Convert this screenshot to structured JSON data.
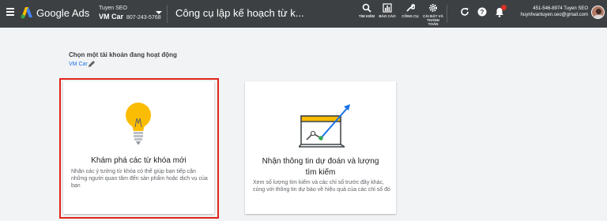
{
  "header": {
    "brand": "Google Ads",
    "account_top": "Tuyen SEO",
    "account_name": "VM Car",
    "account_id": "807-243-5768",
    "page_title": "Công cụ lập kế hoạch từ k...",
    "tools": [
      {
        "label": "TÌM KIẾM",
        "icon": "search-icon"
      },
      {
        "label": "BÁO CÁO",
        "icon": "reports-icon"
      },
      {
        "label": "CÔNG CỤ",
        "icon": "wrench-icon"
      },
      {
        "label1": "CÀI ĐẶT VÀ",
        "label2": "THANH",
        "label3": "TOÁN",
        "icon": "gear-icon"
      }
    ],
    "user_line1": "451-546-8974 Tuyen SEO",
    "user_line2": "huynhvantuyen.seo@gmail.com"
  },
  "content": {
    "choose_label": "Chọn một tài khoản đang hoạt động",
    "account_link": "VM Car"
  },
  "cards": [
    {
      "title": "Khám phá các từ khóa mới",
      "desc": "Nhận các ý tưởng từ khóa có thể giúp bạn tiếp cận những người quan tâm đến sản phẩm hoặc dịch vụ của bạn",
      "icon": "lightbulb-icon"
    },
    {
      "title_line1": "Nhận thông tin dự đoán và lượng",
      "title_line2": "tìm kiếm",
      "desc": "Xem số lượng tìm kiếm và các chỉ số trước đây khác, cùng với thông tin dự báo về hiệu quả của các chỉ số đó",
      "icon": "forecast-chart-icon"
    }
  ],
  "colors": {
    "topbar": "#3c4043",
    "accent": "#1a73e8",
    "highlight_border": "#e2231a",
    "bulb": "#fbbc04",
    "badge": "#d93025"
  }
}
